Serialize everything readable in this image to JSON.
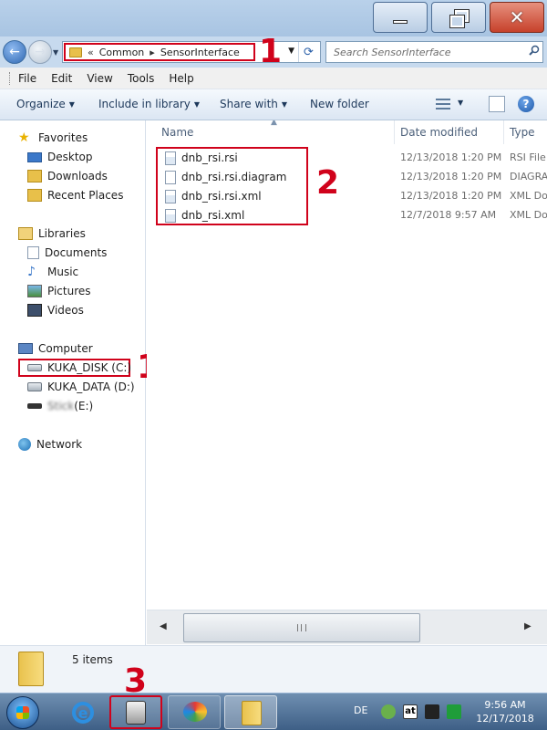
{
  "window": {
    "minimize_label": "",
    "maximize_label": "",
    "close_label": "✕"
  },
  "address": {
    "overflow": "«",
    "breadcrumbs": [
      "Common",
      "SensorInterface"
    ],
    "search_placeholder": "Search SensorInterface"
  },
  "menu": [
    "File",
    "Edit",
    "View",
    "Tools",
    "Help"
  ],
  "commands": {
    "organize": "Organize",
    "include_in_library": "Include in library",
    "share_with": "Share with",
    "new_folder": "New folder"
  },
  "nav": {
    "favorites": "Favorites",
    "desktop": "Desktop",
    "downloads": "Downloads",
    "recent_places": "Recent Places",
    "libraries": "Libraries",
    "documents": "Documents",
    "music": "Music",
    "pictures": "Pictures",
    "videos": "Videos",
    "computer": "Computer",
    "drive_c": "KUKA_DISK (C:)",
    "drive_d": "KUKA_DATA (D:)",
    "drive_e_name": "Stick",
    "drive_e_letter": "(E:)",
    "network": "Network"
  },
  "columns": {
    "name": "Name",
    "date": "Date modified",
    "type": "Type"
  },
  "files": [
    {
      "name": "dnb_rsi.rsi",
      "date": "12/13/2018 1:20 PM",
      "type": "RSI File",
      "icon": "file-icon"
    },
    {
      "name": "dnb_rsi.rsi.diagram",
      "date": "12/13/2018 1:20 PM",
      "type": "DIAGRAM",
      "icon": "file-icon"
    },
    {
      "name": "dnb_rsi.rsi.xml",
      "date": "12/13/2018 1:20 PM",
      "type": "XML Do",
      "icon": "xml-file-icon"
    },
    {
      "name": "dnb_rsi.xml",
      "date": "12/7/2018 9:57 AM",
      "type": "XML Do",
      "icon": "xml-file-icon"
    }
  ],
  "status": {
    "items": "5 items"
  },
  "annotations": {
    "one_address": "1",
    "one_drive": "1",
    "two": "2",
    "three": "3"
  },
  "taskbar": {
    "language": "DE",
    "tray_at": "at",
    "time": "9:56 AM",
    "date": "12/17/2018"
  },
  "colors": {
    "annotation": "#d0021b",
    "titlebar": "#b9d1ea",
    "taskbar": "#3e5f86"
  }
}
